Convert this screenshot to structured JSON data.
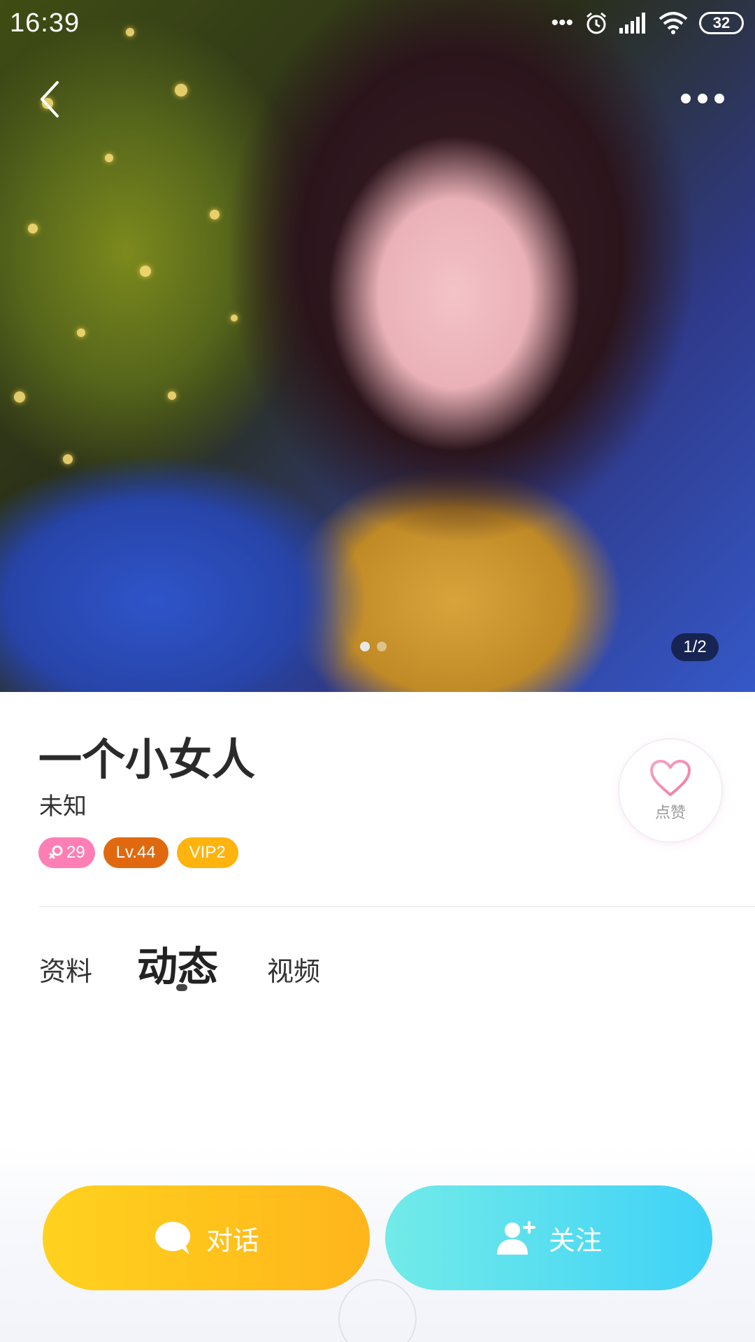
{
  "status_bar": {
    "time": "16:39",
    "battery": "32",
    "icons": [
      "more-dots-icon",
      "alarm-icon",
      "signal-icon",
      "wifi-icon",
      "battery-icon"
    ]
  },
  "photo": {
    "counter": "1/2",
    "current_index": 1,
    "total": 2
  },
  "profile": {
    "name": "一个小女人",
    "gender": "未知",
    "badges": {
      "age": "29",
      "level": "Lv.44",
      "vip": "VIP2"
    },
    "like_label": "点赞"
  },
  "tabs": [
    {
      "label": "资料",
      "active": false
    },
    {
      "label": "动态",
      "active": true
    },
    {
      "label": "视频",
      "active": false
    }
  ],
  "actions": {
    "chat_label": "对话",
    "follow_label": "关注"
  },
  "colors": {
    "age_badge": "#ff7fb5",
    "level_badge": "#e0690f",
    "vip_badge": "#ffb30f",
    "chat_button": "#ffc21d",
    "follow_button": "#58dff0",
    "like_heart": "#f58ab0"
  }
}
